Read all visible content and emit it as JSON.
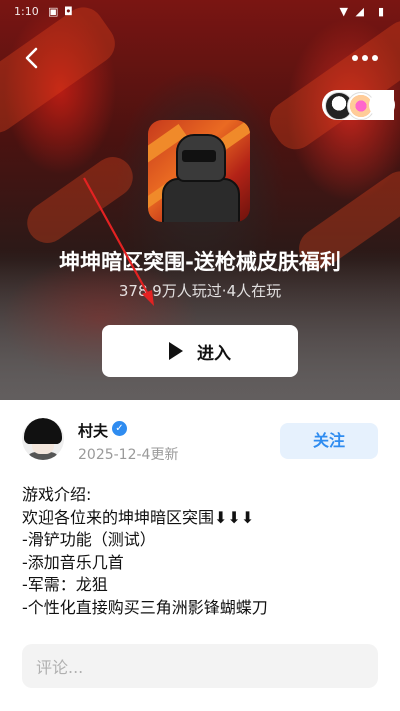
{
  "status_bar": {
    "time": "1:10"
  },
  "game": {
    "title": "坤坤暗区突围-送枪械皮肤福利",
    "stats": "378.9万人玩过·4人在玩",
    "enter_label": "进入"
  },
  "author": {
    "name": "村夫",
    "date": "2025-12-4更新",
    "follow_label": "关注"
  },
  "intro_lines": [
    "游戏介绍:",
    "欢迎各位来的坤坤暗区突围⬇⬇⬇",
    "-滑铲功能（测试）",
    "-添加音乐几首",
    "-军需：龙狙",
    "-个性化直接购买三角洲影锋蝴蝶刀"
  ],
  "comment": {
    "placeholder": "评论..."
  },
  "colors": {
    "accent": "#2f8cf0",
    "follow_bg": "#e6f1fd",
    "arrow": "#e32222"
  }
}
